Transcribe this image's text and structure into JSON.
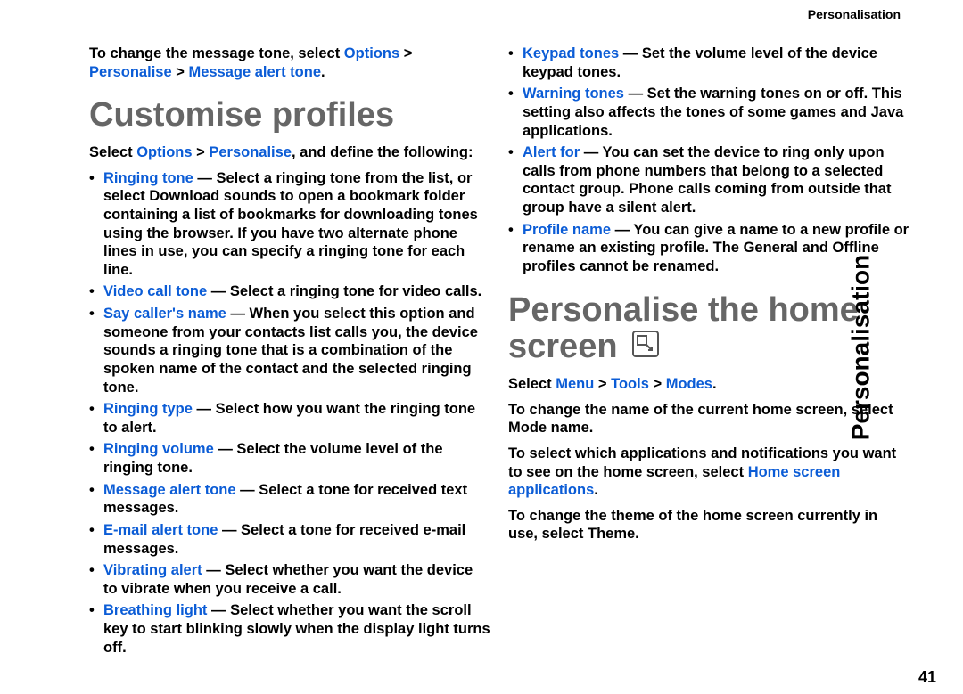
{
  "header": "Personalisation",
  "side_title": "Personalisation",
  "page_number": "41",
  "intro": {
    "prefix": "To change the message tone, select ",
    "link1": "Options",
    "sep1": " > ",
    "link2": "Personalise",
    "sep2": " > ",
    "link3": "Message alert tone",
    "suffix": "."
  },
  "h1": "Customise profiles",
  "select_line": {
    "prefix": "Select ",
    "link1": "Options",
    "sep1": " > ",
    "link2": "Personalise",
    "suffix": ", and define the following:"
  },
  "items_left": [
    {
      "label": "Ringing tone",
      "sep": " — ",
      "text_before": "Select a ringing tone from the list, or select ",
      "bold": "Download sounds",
      "text_after": " to open a bookmark folder containing a list of bookmarks for downloading tones using the browser. If you have two alternate phone lines in use, you can specify a ringing tone for each line."
    },
    {
      "label": "Video call tone",
      "sep": " — ",
      "text": "Select a ringing tone for video calls."
    },
    {
      "label": "Say caller's name",
      "sep": " — ",
      "text": "When you select this option and someone from your contacts list calls you, the device sounds a ringing tone that is a combination of the spoken name of the contact and the selected ringing tone."
    },
    {
      "label": "Ringing type",
      "sep": " — ",
      "text": "Select how you want the ringing tone to alert."
    },
    {
      "label": "Ringing volume",
      "sep": " — ",
      "text": "Select the volume level of the ringing tone."
    },
    {
      "label": "Message alert tone",
      "sep": " — ",
      "text": "Select a tone for received text messages."
    },
    {
      "label": "E-mail alert tone",
      "sep": " — ",
      "text": "Select a tone for received e-mail messages."
    },
    {
      "label": "Vibrating alert",
      "sep": " — ",
      "text": "Select whether you want the device to vibrate when you receive a call."
    }
  ],
  "items_right": [
    {
      "label": "Breathing light",
      "sep": " — ",
      "text": "Select whether you want the scroll key to start blinking slowly when the display light turns off."
    },
    {
      "label": "Keypad tones",
      "sep": " — ",
      "text": "Set the volume level of the device keypad tones."
    },
    {
      "label": "Warning tones",
      "sep": " — ",
      "text": "Set the warning tones on or off. This setting also affects the tones of some games and Java applications."
    },
    {
      "label": "Alert for",
      "sep": " — ",
      "text": "You can set the device to ring only upon calls from phone numbers that belong to a selected contact group. Phone calls coming from outside that group have a silent alert."
    },
    {
      "label": "Profile name",
      "sep": " — ",
      "text": "You can give a name to a new profile or rename an existing profile. The General and Offline profiles cannot be renamed."
    }
  ],
  "h2": "Personalise the home screen",
  "p1": {
    "prefix": "Select ",
    "l1": "Menu",
    "s1": " > ",
    "l2": "Tools",
    "s2": " > ",
    "l3": "Modes",
    "suffix": "."
  },
  "p2": {
    "prefix": "To change the name of the current home screen, select ",
    "bold": "Mode name",
    "suffix": "."
  },
  "p3": {
    "prefix": "To select which applications and notifications you want to see on the home screen, select ",
    "link": "Home screen applications",
    "suffix": "."
  },
  "p4": {
    "prefix": "To change the theme of the home screen currently in use, select ",
    "bold": "Theme",
    "suffix": "."
  }
}
